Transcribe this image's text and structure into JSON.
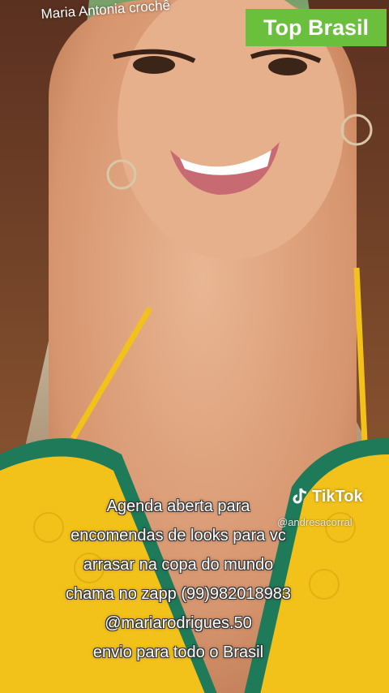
{
  "overlay": {
    "title": "Maria Antonia crochê",
    "badge": "Top Brasil"
  },
  "watermark": {
    "brand": "TikTok",
    "handle": "@andresacorral",
    "icon": "tiktok-note-icon"
  },
  "caption": {
    "lines": [
      "Agenda aberta para",
      "encomendas de looks para vc",
      "arrasar na copa do mundo",
      "chama no zapp (99)982018983",
      "@mariarodrigues.50",
      "envio para todo o Brasil"
    ]
  },
  "colors": {
    "badge_bg": "#6abf3c",
    "crochet_yellow": "#f2c21a",
    "crochet_green": "#1f7a5a"
  }
}
